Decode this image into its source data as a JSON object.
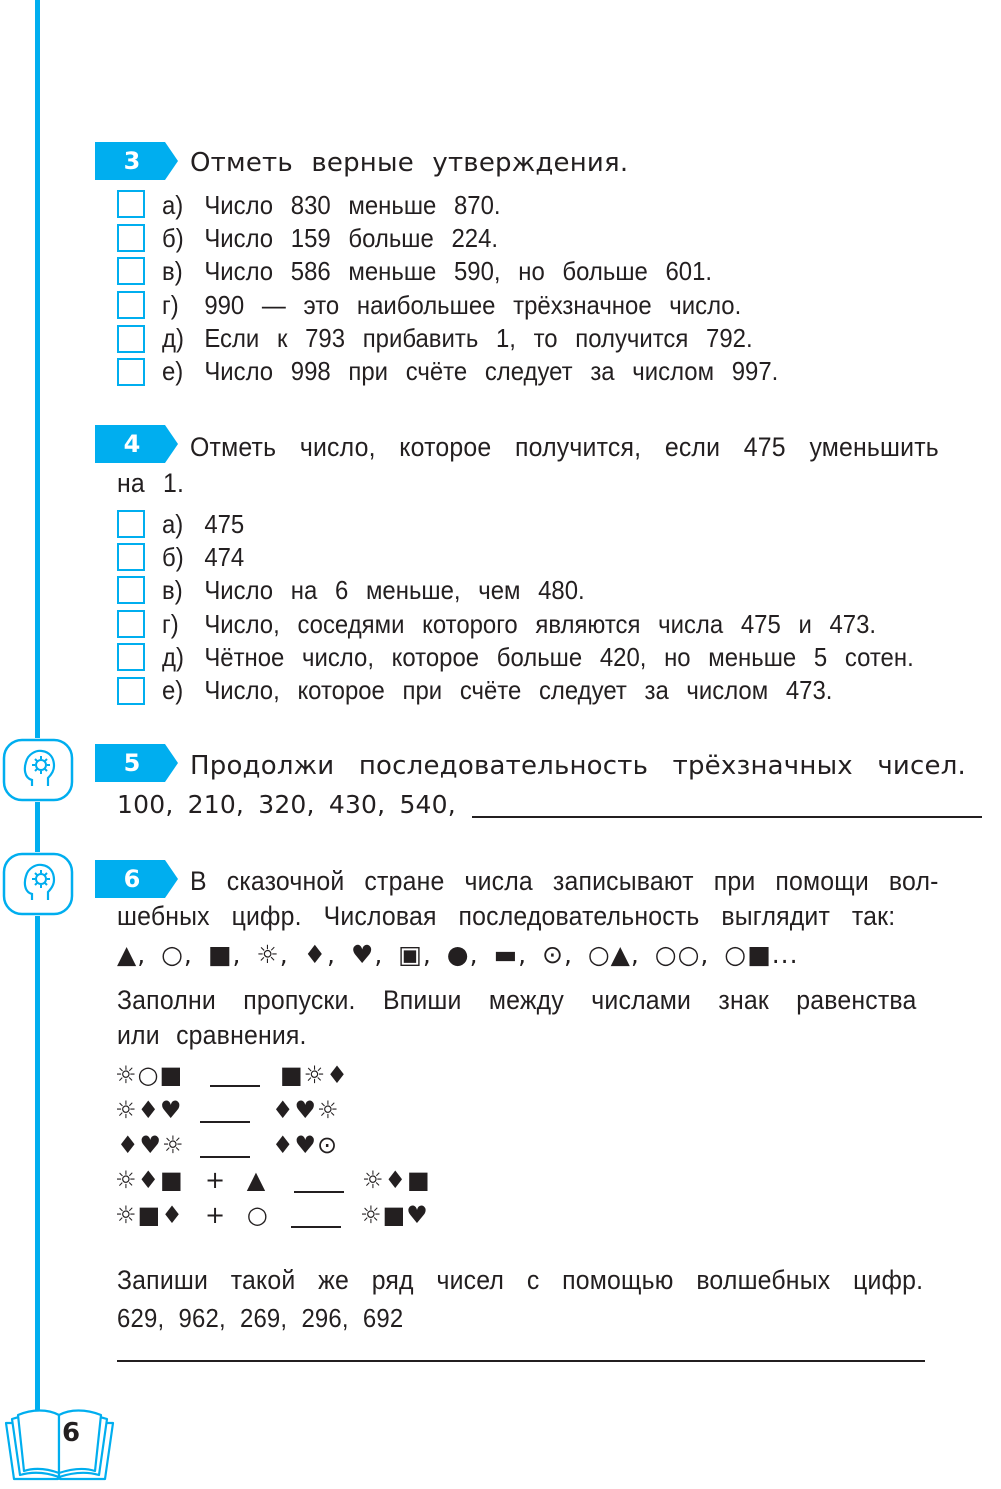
{
  "page_number": "6",
  "colors": {
    "accent": "#00aeef",
    "text": "#231f20"
  },
  "tasks": {
    "t3": {
      "number": "3",
      "title": "Отметь верные утверждения.",
      "options": [
        {
          "label": "а)",
          "text": "Число 830 меньше 870."
        },
        {
          "label": "б)",
          "text": "Число 159 больше 224."
        },
        {
          "label": "в)",
          "text": "Число 586 меньше 590, но больше 601."
        },
        {
          "label": "г)",
          "text": "990 — это наибольшее трёхзначное число."
        },
        {
          "label": "д)",
          "text": "Если к 793 прибавить 1, то получится 792."
        },
        {
          "label": "е)",
          "text": "Число 998 при счёте следует за числом 997."
        }
      ]
    },
    "t4": {
      "number": "4",
      "title_line1": "Отметь число, которое получится, если 475 уменьшить",
      "title_line2": "на 1.",
      "options": [
        {
          "label": "а)",
          "text": "475"
        },
        {
          "label": "б)",
          "text": "474"
        },
        {
          "label": "в)",
          "text": "Число на 6 меньше, чем 480."
        },
        {
          "label": "г)",
          "text": "Число, соседями которого являются числа 475 и 473."
        },
        {
          "label": "д)",
          "text": "Чётное число, которое больше 420, но меньше 5 сотен."
        },
        {
          "label": "е)",
          "text": "Число, которое при счёте следует за числом 473."
        }
      ]
    },
    "t5": {
      "number": "5",
      "icon": "head-gear-icon",
      "title": "Продолжи последовательность трёхзначных чисел.",
      "sequence": "100, 210, 320, 430, 540,",
      "answer": ""
    },
    "t6": {
      "number": "6",
      "icon": "head-gear-icon",
      "title_line1": "В сказочной стране числа записывают при помощи вол-",
      "title_line2": "шебных цифр. Числовая последовательность выглядит так:",
      "magic_sequence": "▲, ○, ■, ☼, ♦, ♥, ▣, ●, ▬, ⊙, ○▲, ○○, ○■...",
      "instruction_line1": "Заполни пропуски. Впиши между числами знак равенства",
      "instruction_line2": "или сравнения.",
      "comparisons": [
        {
          "left": "☼○■",
          "op": "",
          "right": "■☼♦",
          "answer": ""
        },
        {
          "left": "☼♦♥",
          "op": "",
          "right": "♦♥☼",
          "answer": ""
        },
        {
          "left": "♦♥☼",
          "op": "",
          "right": "♦♥⊙",
          "answer": ""
        },
        {
          "left": "☼♦■",
          "op": "+ ▲",
          "right": "☼♦■",
          "answer": ""
        },
        {
          "left": "☼■♦",
          "op": "+ ○",
          "right": "☼■♥",
          "answer": ""
        }
      ],
      "write_instruction": "Запиши такой же ряд чисел с помощью волшебных цифр.",
      "numbers": "629, 962, 269, 296, 692",
      "answer": ""
    }
  }
}
